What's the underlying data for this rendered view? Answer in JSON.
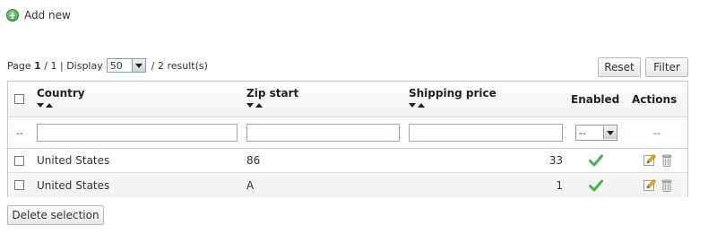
{
  "toolbar": {
    "add_new_label": "Add new"
  },
  "pagination": {
    "page_prefix": "Page",
    "current_page": "1",
    "total_pages": "/ 1 | Display",
    "display_value": "50",
    "results_text": "/ 2 result(s)"
  },
  "buttons": {
    "reset": "Reset",
    "filter": "Filter",
    "delete_selection": "Delete selection"
  },
  "table": {
    "columns": {
      "country": "Country",
      "zip_start": "Zip start",
      "shipping_price": "Shipping price",
      "enabled": "Enabled",
      "actions": "Actions"
    },
    "filters": {
      "row_marker": "--",
      "enabled_value": "--",
      "actions_placeholder": "--"
    },
    "rows": [
      {
        "country": "United States",
        "zip_start": "86",
        "shipping_price": "33",
        "enabled": true
      },
      {
        "country": "United States",
        "zip_start": "A",
        "shipping_price": "1",
        "enabled": true
      }
    ]
  },
  "colors": {
    "accent_green": "#4caf50",
    "header_bg": "#f1f1f1",
    "alt_row_bg": "#f5f5f5",
    "border": "#c8c8c8"
  },
  "icons": {
    "add": "add-circle-icon",
    "enabled": "check-icon",
    "edit": "edit-icon",
    "delete": "trash-icon"
  }
}
